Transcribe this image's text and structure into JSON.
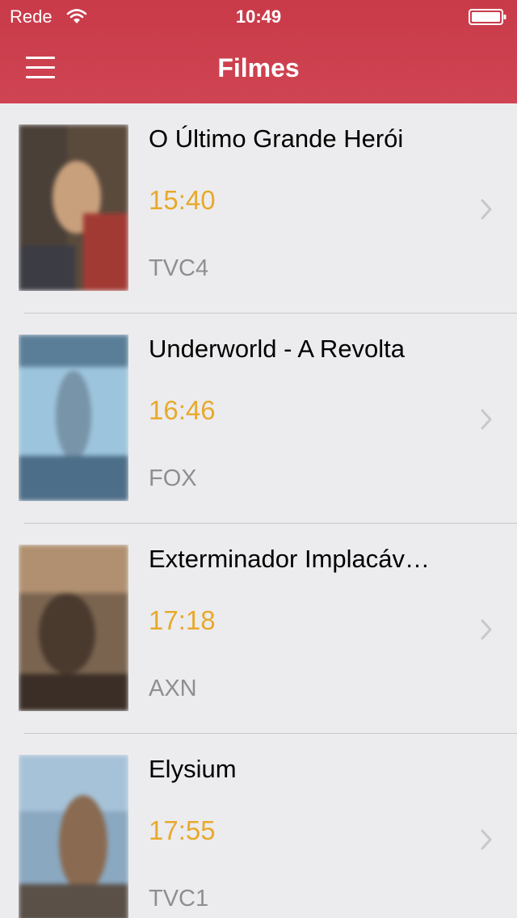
{
  "status_bar": {
    "carrier": "Rede",
    "time": "10:49",
    "wifi_icon": "wifi-icon",
    "battery_icon": "battery-icon"
  },
  "nav": {
    "title": "Filmes",
    "menu_icon": "hamburger-menu-icon"
  },
  "colors": {
    "header": "#cc3e4c",
    "time_text": "#e8a92c",
    "channel_text": "#8e8e93",
    "background": "#efeff4"
  },
  "movies": [
    {
      "title": "O Último Grande Herói",
      "time": "15:40",
      "channel": "TVC4"
    },
    {
      "title": "Underworld - A Revolta",
      "time": "16:46",
      "channel": "FOX"
    },
    {
      "title": "Exterminador Implacáv…",
      "time": "17:18",
      "channel": "AXN"
    },
    {
      "title": "Elysium",
      "time": "17:55",
      "channel": "TVC1"
    }
  ]
}
